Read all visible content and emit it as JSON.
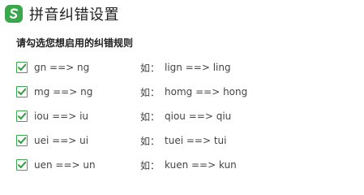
{
  "header": {
    "title": "拼音纠错设置",
    "accent_color": "#3aa74c"
  },
  "section": {
    "subtitle": "请勾选您想启用的纠错规则"
  },
  "rules": [
    {
      "checked": true,
      "rule": "gn ==> ng",
      "example_label": "如：",
      "example": "lign ==> ling"
    },
    {
      "checked": true,
      "rule": "mg ==> ng",
      "example_label": "如：",
      "example": "homg ==> hong"
    },
    {
      "checked": true,
      "rule": "iou ==> iu",
      "example_label": "如：",
      "example": "qiou ==> qiu"
    },
    {
      "checked": true,
      "rule": "uei ==> ui",
      "example_label": "如：",
      "example": "tuei ==> tui"
    },
    {
      "checked": true,
      "rule": "uen ==> un",
      "example_label": "如：",
      "example": "kuen ==> kun"
    }
  ]
}
